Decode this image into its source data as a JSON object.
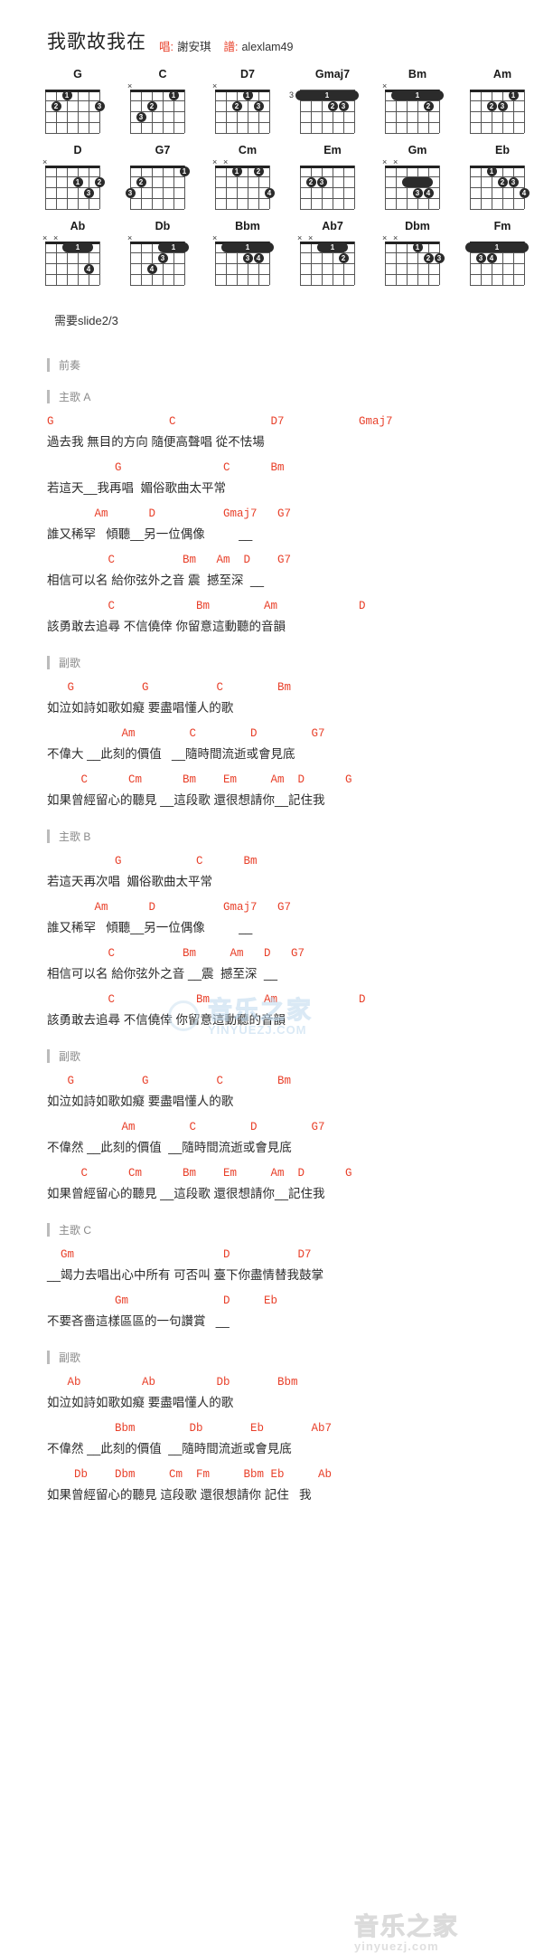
{
  "header": {
    "title": "我歌故我在",
    "singer_label": "唱:",
    "singer": "謝安琪",
    "tab_label": "譜:",
    "tab_author": "alexlam49"
  },
  "note": "需要slide2/3",
  "chords": [
    [
      {
        "name": "G",
        "mutes": "",
        "fret": "",
        "dots": [
          {
            "s": 5,
            "f": 2,
            "n": "2"
          },
          {
            "s": 4,
            "f": 1,
            "n": "1"
          },
          {
            "s": 1,
            "f": 2,
            "n": "3"
          }
        ],
        "barre": null
      },
      {
        "name": "C",
        "mutes": "x.....",
        "fret": "",
        "dots": [
          {
            "s": 5,
            "f": 3,
            "n": "3"
          },
          {
            "s": 4,
            "f": 2,
            "n": "2"
          },
          {
            "s": 2,
            "f": 1,
            "n": "1"
          }
        ],
        "barre": null
      },
      {
        "name": "D7",
        "mutes": "x.....",
        "fret": "",
        "dots": [
          {
            "s": 4,
            "f": 2,
            "n": "2"
          },
          {
            "s": 3,
            "f": 1,
            "n": "1"
          },
          {
            "s": 2,
            "f": 2,
            "n": "3"
          }
        ],
        "barre": null
      },
      {
        "name": "Gmaj7",
        "mutes": "",
        "fret": "3",
        "dots": [
          {
            "s": 3,
            "f": 2,
            "n": "2"
          },
          {
            "s": 2,
            "f": 2,
            "n": "3"
          }
        ],
        "barre": {
          "fret": 1,
          "from": 6,
          "to": 1,
          "n": "1"
        }
      },
      {
        "name": "Bm",
        "mutes": "x.....",
        "fret": "",
        "dots": [
          {
            "s": 2,
            "f": 2,
            "n": "2"
          }
        ],
        "barre": {
          "fret": 1,
          "from": 5,
          "to": 1,
          "n": "1"
        }
      },
      {
        "name": "Am",
        "mutes": "",
        "fret": "",
        "dots": [
          {
            "s": 4,
            "f": 2,
            "n": "2"
          },
          {
            "s": 3,
            "f": 2,
            "n": "3"
          },
          {
            "s": 2,
            "f": 1,
            "n": "1"
          }
        ],
        "barre": null
      }
    ],
    [
      {
        "name": "D",
        "mutes": "x.....",
        "fret": "",
        "dots": [
          {
            "s": 3,
            "f": 2,
            "n": "1"
          },
          {
            "s": 1,
            "f": 2,
            "n": "2"
          },
          {
            "s": 2,
            "f": 3,
            "n": "3"
          }
        ],
        "barre": null
      },
      {
        "name": "G7",
        "mutes": "",
        "fret": "",
        "dots": [
          {
            "s": 5,
            "f": 2,
            "n": "2"
          },
          {
            "s": 1,
            "f": 1,
            "n": "1"
          },
          {
            "s": 6,
            "f": 3,
            "n": "3"
          }
        ],
        "barre": null
      },
      {
        "name": "Cm",
        "mutes": "xx....",
        "fret": "",
        "dots": [
          {
            "s": 4,
            "f": 1,
            "n": "1"
          },
          {
            "s": 2,
            "f": 1,
            "n": "2"
          },
          {
            "s": 1,
            "f": 3,
            "n": "4"
          }
        ],
        "barre": null
      },
      {
        "name": "Em",
        "mutes": "",
        "fret": "",
        "dots": [
          {
            "s": 5,
            "f": 2,
            "n": "2"
          },
          {
            "s": 4,
            "f": 2,
            "n": "3"
          }
        ],
        "barre": null
      },
      {
        "name": "Gm",
        "mutes": "xx....",
        "fret": "",
        "dots": [
          {
            "s": 3,
            "f": 3,
            "n": "3"
          },
          {
            "s": 2,
            "f": 3,
            "n": "4"
          }
        ],
        "barre": {
          "fret": 2,
          "from": 4,
          "to": 2,
          "n": ""
        }
      },
      {
        "name": "Eb",
        "mutes": "",
        "fret": "",
        "dots": [
          {
            "s": 4,
            "f": 1,
            "n": "1"
          },
          {
            "s": 3,
            "f": 2,
            "n": "2"
          },
          {
            "s": 2,
            "f": 2,
            "n": "3"
          },
          {
            "s": 1,
            "f": 3,
            "n": "4"
          }
        ],
        "barre": null
      }
    ],
    [
      {
        "name": "Ab",
        "mutes": "xx....",
        "fret": "",
        "dots": [
          {
            "s": 2,
            "f": 3,
            "n": "4"
          }
        ],
        "barre": {
          "fret": 1,
          "from": 4,
          "to": 2,
          "n": "1"
        }
      },
      {
        "name": "Db",
        "mutes": "x.....",
        "fret": "",
        "dots": [
          {
            "s": 3,
            "f": 2,
            "n": "3"
          },
          {
            "s": 4,
            "f": 3,
            "n": "4"
          }
        ],
        "barre": {
          "fret": 1,
          "from": 3,
          "to": 1,
          "n": "1"
        }
      },
      {
        "name": "Bbm",
        "mutes": "x.....",
        "fret": "",
        "dots": [
          {
            "s": 3,
            "f": 2,
            "n": "3"
          },
          {
            "s": 2,
            "f": 2,
            "n": "4"
          }
        ],
        "barre": {
          "fret": 1,
          "from": 5,
          "to": 1,
          "n": "1"
        }
      },
      {
        "name": "Ab7",
        "mutes": "xx....",
        "fret": "",
        "dots": [
          {
            "s": 2,
            "f": 2,
            "n": "2"
          }
        ],
        "barre": {
          "fret": 1,
          "from": 4,
          "to": 2,
          "n": "1"
        }
      },
      {
        "name": "Dbm",
        "mutes": "xx....",
        "fret": "",
        "dots": [
          {
            "s": 3,
            "f": 1,
            "n": "1"
          },
          {
            "s": 2,
            "f": 2,
            "n": "2"
          },
          {
            "s": 1,
            "f": 2,
            "n": "3"
          }
        ],
        "barre": null
      },
      {
        "name": "Fm",
        "mutes": "",
        "fret": "",
        "dots": [
          {
            "s": 5,
            "f": 2,
            "n": "3"
          },
          {
            "s": 4,
            "f": 2,
            "n": "4"
          }
        ],
        "barre": {
          "fret": 1,
          "from": 6,
          "to": 1,
          "n": "1"
        }
      }
    ]
  ],
  "sections": [
    {
      "label": "前奏",
      "lines": []
    },
    {
      "label": "主歌 A",
      "lines": [
        {
          "chords": "G                 C              D7           Gmaj7",
          "lyric": "過去我 無目的方向 隨便高聲唱 從不怯場"
        },
        {
          "chords": "          G               C      Bm",
          "lyric": "若這天__我再唱  媚俗歌曲太平常"
        },
        {
          "chords": "       Am      D          Gmaj7   G7",
          "lyric": "誰又稀罕   傾聽__另一位偶像          __"
        },
        {
          "chords": "         C          Bm   Am  D    G7",
          "lyric": "相信可以名 給你弦外之音 震  撼至深  __"
        },
        {
          "chords": "         C            Bm        Am            D",
          "lyric": "該勇敢去追尋 不信僥倖 你留意這動聽的音韻"
        }
      ]
    },
    {
      "label": "副歌",
      "lines": [
        {
          "chords": "   G          G          C        Bm",
          "lyric": "如泣如詩如歌如癡 要盡唱懂人的歌"
        },
        {
          "chords": "           Am        C        D        G7",
          "lyric": "不偉大 __此刻的價值   __隨時間流逝或會見底"
        },
        {
          "chords": "     C      Cm      Bm    Em     Am  D      G",
          "lyric": "如果曾經留心的聽見 __這段歌 還很想請你__記住我"
        }
      ]
    },
    {
      "label": "主歌 B",
      "lines": [
        {
          "chords": "          G           C      Bm",
          "lyric": "若這天再次唱  媚俗歌曲太平常"
        },
        {
          "chords": "       Am      D          Gmaj7   G7",
          "lyric": "誰又稀罕   傾聽__另一位偶像          __"
        },
        {
          "chords": "         C          Bm     Am   D   G7",
          "lyric": "相信可以名 給你弦外之音 __震  撼至深  __"
        },
        {
          "chords": "         C            Bm        Am            D",
          "lyric": "該勇敢去追尋 不信僥倖 你留意這動聽的音韻"
        }
      ]
    },
    {
      "label": "副歌",
      "lines": [
        {
          "chords": "   G          G          C        Bm",
          "lyric": "如泣如詩如歌如癡 要盡唱懂人的歌"
        },
        {
          "chords": "           Am        C        D        G7",
          "lyric": "不偉然 __此刻的價值  __隨時間流逝或會見底"
        },
        {
          "chords": "     C      Cm      Bm    Em     Am  D      G",
          "lyric": "如果曾經留心的聽見 __這段歌 還很想請你__記住我"
        }
      ]
    },
    {
      "label": "主歌 C",
      "lines": [
        {
          "chords": "  Gm                      D          D7",
          "lyric": "__竭力去唱出心中所有 可否叫 臺下你盡情替我鼓掌"
        },
        {
          "chords": "          Gm              D     Eb",
          "lyric": "不要吝嗇這樣區區的一句讚賞   __"
        }
      ]
    },
    {
      "label": "副歌",
      "lines": [
        {
          "chords": "   Ab         Ab         Db       Bbm",
          "lyric": "如泣如詩如歌如癡 要盡唱懂人的歌"
        },
        {
          "chords": "          Bbm        Db       Eb       Ab7",
          "lyric": "不偉然 __此刻的價值  __隨時間流逝或會見底"
        },
        {
          "chords": "    Db    Dbm     Cm  Fm     Bbm Eb     Ab",
          "lyric": "如果曾經留心的聽見 這段歌 還很想請你 記住   我"
        }
      ]
    }
  ],
  "watermarks": {
    "middle_main": "音乐之家",
    "middle_sub": "YINYUEZJ.COM",
    "bottom_main": "音乐之家",
    "bottom_sub": "yinyuezj.com"
  }
}
